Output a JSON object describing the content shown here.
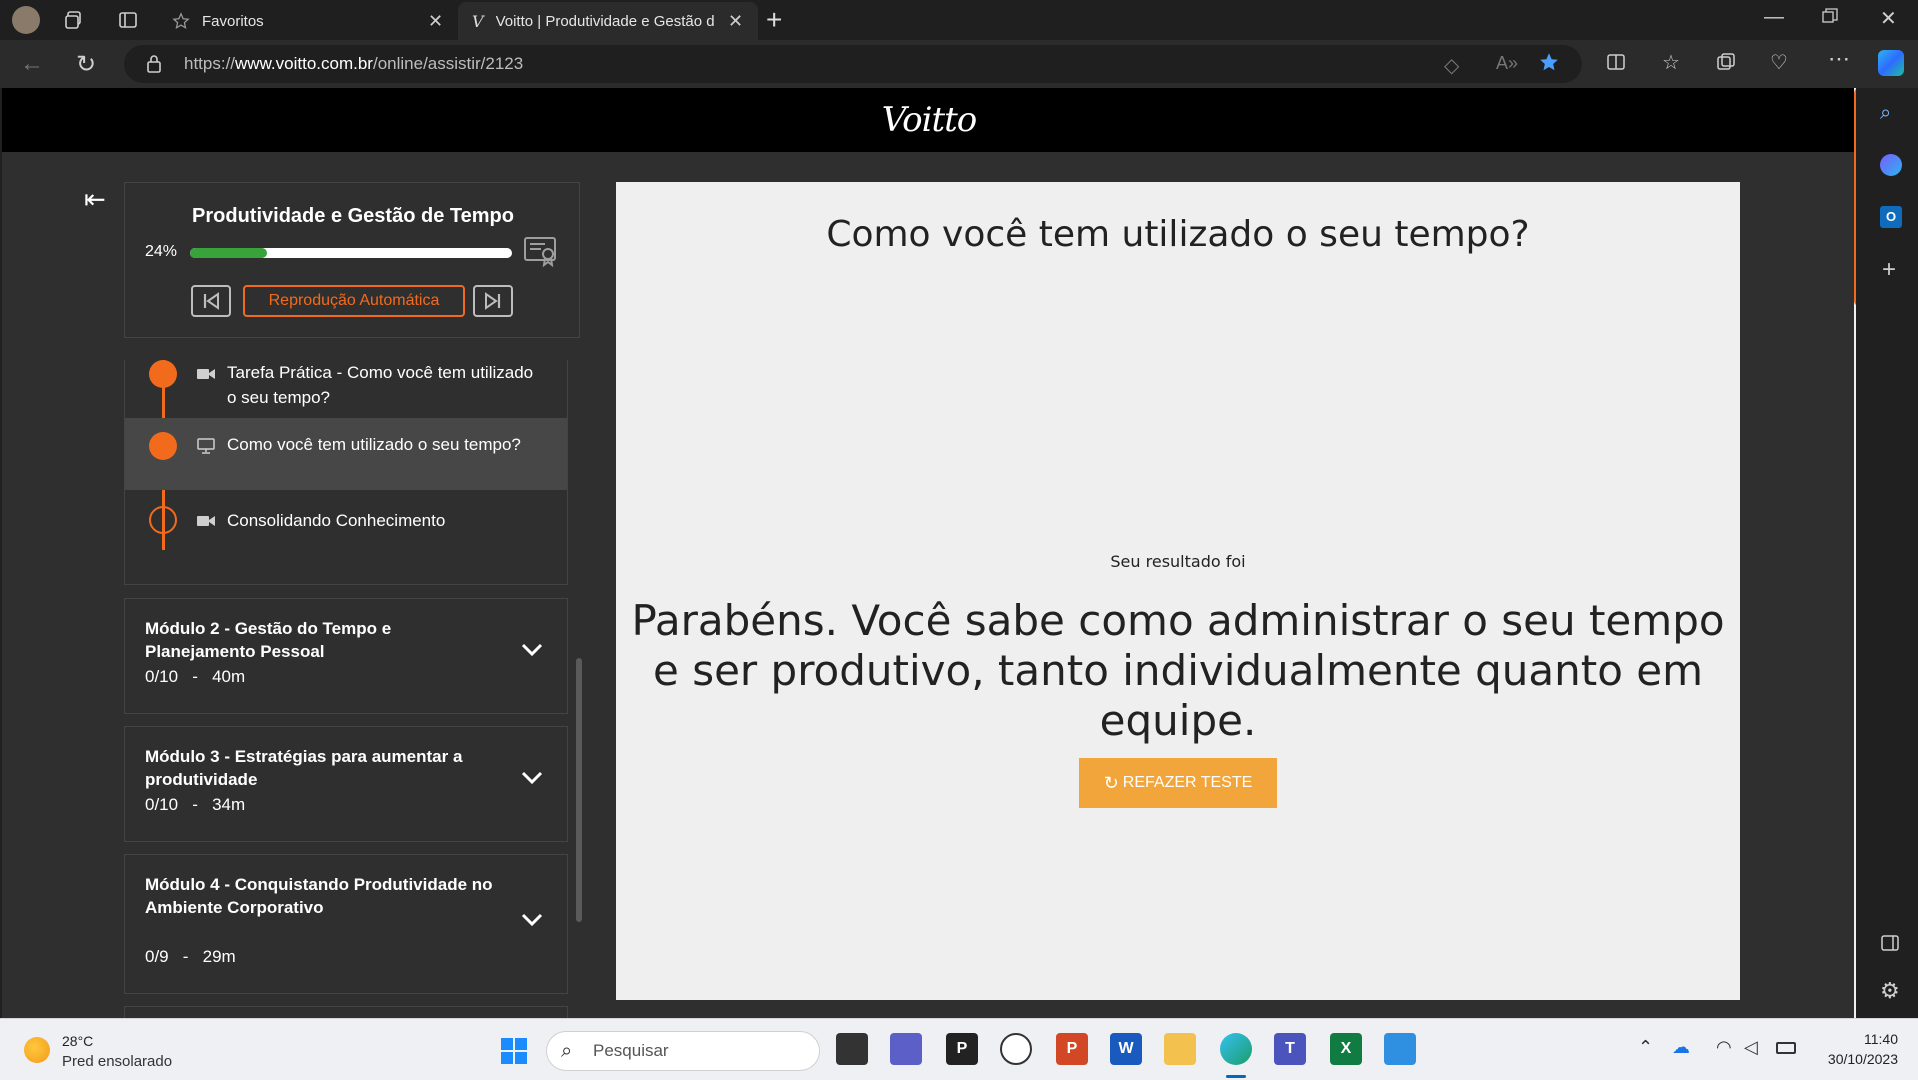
{
  "browser": {
    "tabs": [
      {
        "title": "Favoritos"
      },
      {
        "title": "Voitto | Produtividade e Gestão d"
      }
    ],
    "url_prefix": "https://",
    "url_domain": "www.voitto.com.br",
    "url_path": "/online/assistir/2123"
  },
  "site": {
    "logo": "Voitto"
  },
  "course": {
    "title": "Produtividade e Gestão de Tempo",
    "progress_label": "24%",
    "progress": 0.24,
    "autoplay_label": "Reprodução Automática"
  },
  "lessons": [
    {
      "label": "Tarefa Prática - Como você tem utilizado o seu tempo?",
      "icon": "video-icon",
      "state": "done"
    },
    {
      "label": "Como você tem utilizado o seu tempo?",
      "icon": "monitor-icon",
      "state": "current"
    },
    {
      "label": "Consolidando Conhecimento",
      "icon": "video-icon",
      "state": "pending"
    }
  ],
  "modules": [
    {
      "title": "Módulo 2 - Gestão do Tempo e Planejamento Pessoal",
      "meta": "0/10   -   40m"
    },
    {
      "title": "Módulo 3 - Estratégias para aumentar a produtividade",
      "meta": "0/10   -   34m"
    },
    {
      "title": "Módulo 4 - Conquistando Produtividade no Ambiente Corporativo",
      "meta": "0/9   -   29m"
    }
  ],
  "content": {
    "question": "Como você tem utilizado o seu tempo?",
    "result_label": "Seu resultado foi",
    "result_text": "Parabéns. Você sabe como administrar o seu tempo e ser produtivo, tanto individualmente quanto em equipe.",
    "redo_button": "REFAZER TESTE"
  },
  "taskbar": {
    "weather_temp": "28°C",
    "weather_desc": "Pred ensolarado",
    "search_placeholder": "Pesquisar",
    "time": "11:40",
    "date": "30/10/2023"
  },
  "colors": {
    "accent": "#f26b1d",
    "progress": "#38a33b",
    "redo": "#f1a53b"
  }
}
